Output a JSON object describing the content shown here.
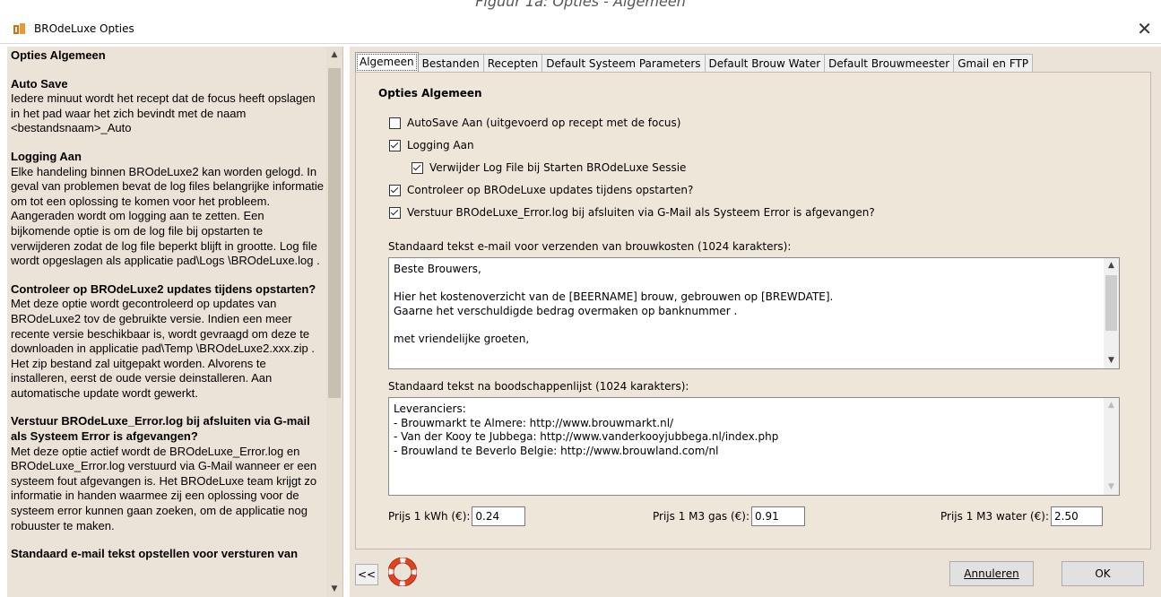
{
  "caption": "Figuur 1a: Opties - Algemeen",
  "window": {
    "title": "BROdeLuxe Opties",
    "close_glyph": "✕"
  },
  "help": {
    "sections": [
      {
        "heading": "Opties Algemeen",
        "text": ""
      },
      {
        "heading": "Auto Save",
        "text": "Iedere minuut wordt het recept dat de focus heeft opslagen in het pad waar het zich bevindt met de naam <bestandsnaam>_Auto"
      },
      {
        "heading": "Logging Aan",
        "text": "Elke handeling binnen BROdeLuxe2 kan worden gelogd. In geval van problemen bevat de log files belangrijke informatie om tot een oplossing te komen voor het probleem. Aangeraden wordt om logging aan te zetten. Een bijkomende optie is om de log file bij opstarten te verwijderen zodat de log file beperkt blijft in grootte. Log file wordt opgeslagen als applicatie pad\\Logs \\BROdeLuxe.log ."
      },
      {
        "heading": "Controleer op BROdeLuxe2 updates tijdens opstarten?",
        "text": "Met deze optie wordt gecontroleerd op updates van BROdeLuxe2 tov de gebruikte versie. Indien een meer recente versie beschikbaar is, wordt gevraagd om deze te downloaden in applicatie pad\\Temp \\BROdeLuxe2.xxx.zip . Het zip bestand zal uitgepakt worden. Alvorens te installeren, eerst de oude versie deinstalleren. Aan automatische update wordt gewerkt."
      },
      {
        "heading": "Verstuur BROdeLuxe_Error.log bij afsluiten via G-mail als Systeem Error is afgevangen?",
        "text": "Met deze optie actief wordt de BROdeLuxe_Error.log en BROdeLuxe_Error.log verstuurd via G-Mail wanneer er een systeem fout afgevangen is. Het BROdeLuxe team krijgt zo informatie in handen waarmee zij een oplossing voor de systeem error kunnen gaan zoeken, om de applicatie nog robuuster te maken."
      },
      {
        "heading": "Standaard e-mail tekst opstellen voor versturen van",
        "text": ""
      }
    ]
  },
  "tabs": [
    {
      "label": "Algemeen",
      "active": true
    },
    {
      "label": "Bestanden"
    },
    {
      "label": "Recepten"
    },
    {
      "label": "Default Systeem Parameters"
    },
    {
      "label": "Default Brouw Water"
    },
    {
      "label": "Default Brouwmeester"
    },
    {
      "label": "Gmail en FTP"
    }
  ],
  "panel": {
    "title": "Opties Algemeen",
    "options": {
      "autosave": {
        "label": "AutoSave Aan (uitgevoerd op recept met de focus)",
        "checked": false
      },
      "logging": {
        "label": "Logging Aan",
        "checked": true
      },
      "delete_log": {
        "label": "Verwijder Log File bij Starten BROdeLuxe Sessie",
        "checked": true
      },
      "check_updates": {
        "label": "Controleer op BROdeLuxe updates tijdens opstarten?",
        "checked": true
      },
      "send_error": {
        "label": "Verstuur BROdeLuxe_Error.log bij afsluiten via G-Mail als Systeem Error is afgevangen?",
        "checked": true
      }
    },
    "email_label": "Standaard tekst e-mail voor verzenden van brouwkosten (1024 karakters):",
    "email_text": "Beste Brouwers,\n\nHier het kostenoverzicht van de [BEERNAME] brouw, gebrouwen op [BREWDATE].\nGaarne het verschuldigde bedrag overmaken op banknummer .\n\nmet vriendelijke groeten,",
    "shopping_label": "Standaard tekst na boodschappenlijst (1024 karakters):",
    "shopping_text": "Leveranciers:\n- Brouwmarkt te Almere: http://www.brouwmarkt.nl/\n- Van der Kooy te Jubbega: http://www.vanderkooyjubbega.nl/index.php\n- Brouwland te Beverlo Belgie: http://www.brouwland.com/nl",
    "prices": {
      "kwh_label": "Prijs 1 kWh (€):",
      "kwh_value": "0.24",
      "gas_label": "Prijs 1 M3 gas (€):",
      "gas_value": "0.91",
      "water_label": "Prijs 1 M3 water (€):",
      "water_value": "2.50"
    }
  },
  "footer": {
    "collapse_label": "<<",
    "cancel_label": "Annuleren",
    "ok_label": "OK"
  },
  "icons": [
    "app-icon",
    "close-icon",
    "lifebuoy-icon",
    "chevron-up-icon",
    "chevron-down-icon"
  ]
}
